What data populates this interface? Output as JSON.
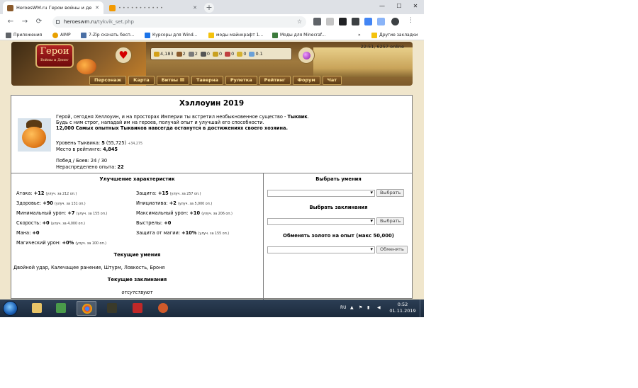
{
  "browser": {
    "tabs": [
      {
        "label": "HeroesWM.ru Герои войны и де",
        "active": true
      },
      {
        "label": "• • • • • • • • • • •",
        "active": false
      }
    ],
    "new_tab": "+",
    "url_host": "heroeswm.ru",
    "url_path": "/tykvik_set.php",
    "win_min": "—",
    "win_max": "☐",
    "win_close": "✕",
    "back": "←",
    "forward": "→",
    "reload": "⟳",
    "bookmarks": [
      {
        "label": "Приложения",
        "color": "#5f6368"
      },
      {
        "label": "AIMP",
        "color": "#e8a000"
      },
      {
        "label": "7-Zip скачать бесп...",
        "color": "#4a6fa5"
      },
      {
        "label": "Курсоры для Wind...",
        "color": "#1a73e8"
      },
      {
        "label": "моды майнкрафт 1...",
        "color": "#f4c20d"
      },
      {
        "label": "Моды для Minecraf...",
        "color": "#3c7a3c"
      },
      {
        "label": "Другие закладки",
        "color": "#f4c20d"
      }
    ],
    "bookmarks_more": "»"
  },
  "game": {
    "logo_text": "Герои",
    "logo_sub": "Войны и Денег",
    "resources": [
      {
        "value": "4,183",
        "color": "#d4a017"
      },
      {
        "value": "2",
        "color": "#8b5a2b"
      },
      {
        "value": "2",
        "color": "#7a7a7a"
      },
      {
        "value": "0",
        "color": "#555555"
      },
      {
        "value": "0",
        "color": "#c9a020"
      },
      {
        "value": "0",
        "color": "#c04040"
      },
      {
        "value": "0",
        "color": "#d4b030"
      },
      {
        "value": "0.1",
        "color": "#6aa0d8"
      }
    ],
    "clock": "22:51, 6257 online",
    "nav": [
      "Персонаж",
      "Карта",
      "Битвы",
      "Таверна",
      "Рулетка",
      "Рейтинг",
      "Форум",
      "Чат"
    ]
  },
  "event": {
    "title": "Хэллоуин 2019",
    "intro_line1_a": "Герой, сегодня Хеллоуин, и на просторах Империи ты встретил необыкновенное существо - ",
    "intro_line1_b": "Тыквик",
    "intro_line1_c": ".",
    "intro_line2": "Будь с ним строг, нападай им на героев, получай опыт и улучшай его способности.",
    "intro_line3": "12,000 Самых опытных Тыквиков навсегда останутся в достижениях своего хозяина.",
    "level_label": "Уровень Тыквика: ",
    "level_value": "5",
    "level_exp": " (55,725)",
    "level_next": "+34,275",
    "rank_label": "Место в рейтинге: ",
    "rank_value": "4,845",
    "wins_label": "Побед / Боев: 24 / 30",
    "free_exp_label": "Нераспределено опыта: ",
    "free_exp_value": "22"
  },
  "upgrade": {
    "title": "Улучшение характеристик",
    "left": [
      {
        "label": "Атака: ",
        "value": "+12",
        "note": "(улуч. за 212 оп.)"
      },
      {
        "label": "Здоровье: ",
        "value": "+90",
        "note": "(улуч. за 131 оп.)"
      },
      {
        "label": "Минимальный урон: ",
        "value": "+7",
        "note": "(улуч. за 155 оп.)"
      },
      {
        "label": "Скорость: ",
        "value": "+0",
        "note": "(улуч. за 4,000 оп.)"
      },
      {
        "label": "Мана: ",
        "value": "+0",
        "note": ""
      },
      {
        "label": "Магический урон: ",
        "value": "+0%",
        "note": "(улуч. за 100 оп.)"
      }
    ],
    "right": [
      {
        "label": "Защита: ",
        "value": "+15",
        "note": "(улуч. за 257 оп.)"
      },
      {
        "label": "Инициатива: ",
        "value": "+2",
        "note": "(улуч. за 5,000 оп.)"
      },
      {
        "label": "Максимальный урон: ",
        "value": "+10",
        "note": "(улуч. за 206 оп.)"
      },
      {
        "label": "Выстрелы: ",
        "value": "+0",
        "note": ""
      },
      {
        "label": "Защита от магии: ",
        "value": "+10%",
        "note": "(улуч. за 155 оп.)"
      }
    ],
    "skills_title": "Текущие умения",
    "skills_list": "Двойной удар, Калечащее ранение, Штурм, Ловкость, Броня",
    "spells_title": "Текущие заклинания",
    "spells_list": "отсутствуют"
  },
  "actions": {
    "skills_title": "Выбрать умения",
    "skills_button": "Выбрать",
    "spells_title": "Выбрать заклинания",
    "spells_button": "Выбрать",
    "exchange_title": "Обменять золото на опыт (макс 50,000)",
    "exchange_button": "Обменять"
  },
  "taskbar": {
    "lang": "RU",
    "time": "0:52",
    "date": "01.11.2019"
  }
}
